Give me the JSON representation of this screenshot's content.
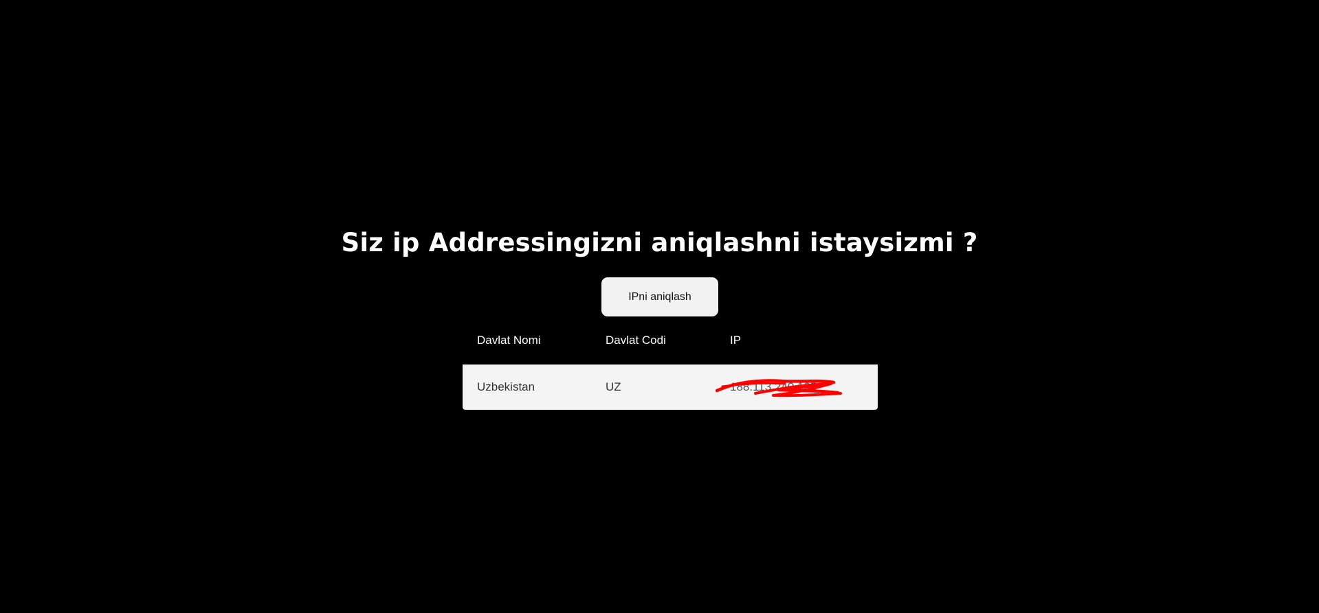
{
  "page": {
    "heading": "Siz ip Addressingizni aniqlashni istaysizmi ?",
    "button_label": "IPni aniqlash"
  },
  "table": {
    "headers": [
      "Davlat Nomi",
      "Davlat Codi",
      "IP"
    ],
    "rows": [
      {
        "country_name": "Uzbekistan",
        "country_code": "UZ",
        "ip": "188.113.240.105"
      }
    ]
  },
  "colors": {
    "background": "#000000",
    "heading_text": "#ffffff",
    "button_bg": "#f2f2f2",
    "row_bg": "#f4f4f4",
    "redaction": "#ff0000"
  },
  "icons": {
    "redaction_mark": "red-scribble"
  }
}
